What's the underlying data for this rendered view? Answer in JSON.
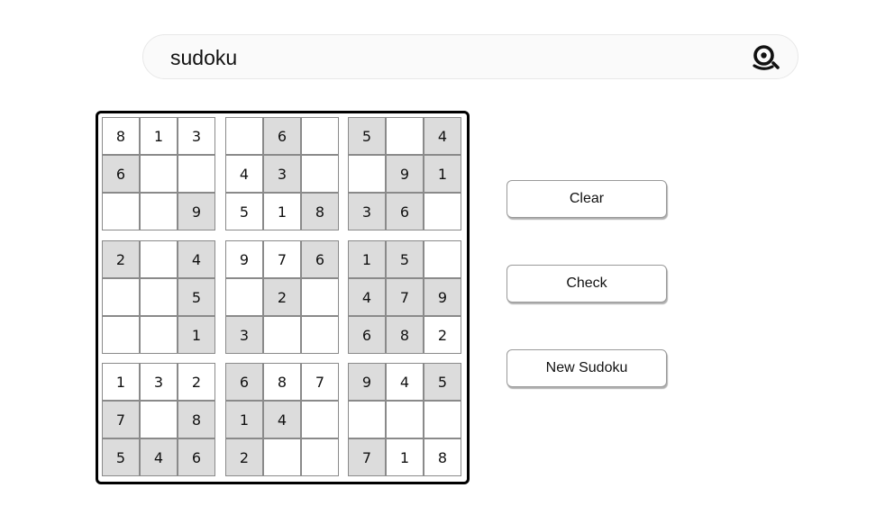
{
  "search": {
    "query": "sudoku",
    "icon": "search-icon"
  },
  "board": {
    "shaded_color": "#dcdcdc",
    "rows": [
      [
        "8",
        "1",
        "3",
        "",
        "6",
        "",
        "5",
        "",
        "4"
      ],
      [
        "6",
        "",
        "",
        "4",
        "3",
        "",
        "",
        "9",
        "1"
      ],
      [
        "",
        "",
        "9",
        "5",
        "1",
        "8",
        "3",
        "6",
        ""
      ],
      [
        "2",
        "",
        "4",
        "9",
        "7",
        "6",
        "1",
        "5",
        ""
      ],
      [
        "",
        "",
        "5",
        "",
        "2",
        "",
        "4",
        "7",
        "9"
      ],
      [
        "",
        "",
        "1",
        "3",
        "",
        "",
        "6",
        "8",
        "2"
      ],
      [
        "1",
        "3",
        "2",
        "6",
        "8",
        "7",
        "9",
        "4",
        "5"
      ],
      [
        "7",
        "",
        "8",
        "1",
        "4",
        "",
        "",
        "",
        ""
      ],
      [
        "5",
        "4",
        "6",
        "2",
        "",
        "",
        "7",
        "1",
        "8"
      ]
    ],
    "shaded": [
      [
        0,
        0,
        0,
        0,
        1,
        0,
        1,
        0,
        1
      ],
      [
        1,
        0,
        0,
        0,
        1,
        0,
        0,
        1,
        1
      ],
      [
        0,
        0,
        1,
        0,
        0,
        1,
        1,
        1,
        0
      ],
      [
        1,
        0,
        1,
        0,
        0,
        1,
        1,
        1,
        0
      ],
      [
        0,
        0,
        1,
        0,
        1,
        0,
        1,
        1,
        1
      ],
      [
        0,
        0,
        1,
        1,
        0,
        0,
        1,
        1,
        0
      ],
      [
        0,
        0,
        0,
        1,
        0,
        0,
        1,
        0,
        1
      ],
      [
        1,
        0,
        1,
        1,
        1,
        0,
        0,
        0,
        0
      ],
      [
        1,
        1,
        1,
        1,
        0,
        0,
        1,
        0,
        0
      ]
    ]
  },
  "controls": {
    "clear_label": "Clear",
    "check_label": "Check",
    "new_label": "New Sudoku"
  }
}
